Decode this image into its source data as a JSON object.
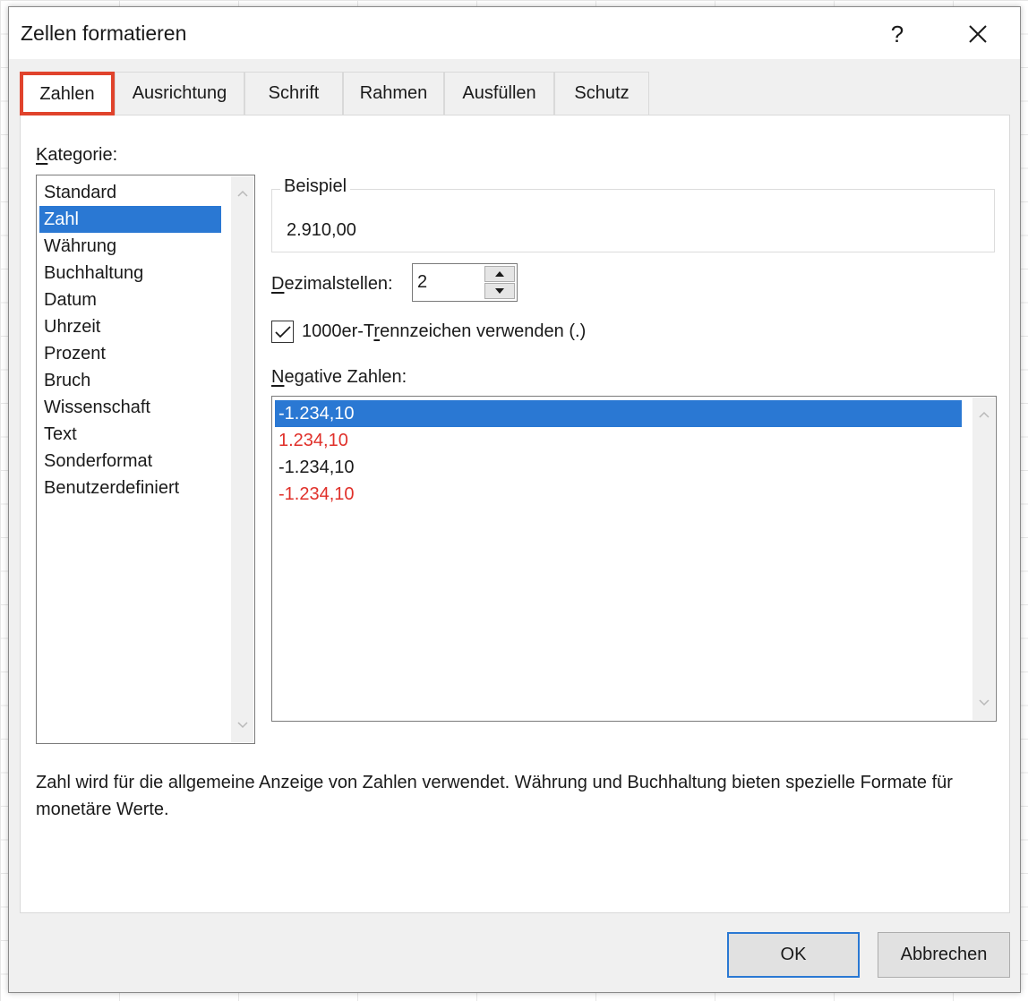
{
  "dialog": {
    "title": "Zellen formatieren",
    "help_label": "?",
    "close_label": "✕"
  },
  "tabs": [
    {
      "label": "Zahlen",
      "active": true
    },
    {
      "label": "Ausrichtung"
    },
    {
      "label": "Schrift"
    },
    {
      "label": "Rahmen"
    },
    {
      "label": "Ausfüllen"
    },
    {
      "label": "Schutz"
    }
  ],
  "category": {
    "label_key": "K",
    "label_rest": "ategorie:",
    "selected": "Zahl",
    "items": [
      "Standard",
      "Zahl",
      "Währung",
      "Buchhaltung",
      "Datum",
      "Uhrzeit",
      "Prozent",
      "Bruch",
      "Wissenschaft",
      "Text",
      "Sonderformat",
      "Benutzerdefiniert"
    ]
  },
  "example": {
    "legend": "Beispiel",
    "value": "2.910,00"
  },
  "decimals": {
    "label_key": "D",
    "label_rest": "ezimalstellen:",
    "value": "2"
  },
  "thousands": {
    "checked": true,
    "label_pre": "1000er-T",
    "label_key": "r",
    "label_post": "ennzeichen verwenden (.)"
  },
  "negative": {
    "label_key": "N",
    "label_rest": "egative Zahlen:",
    "items": [
      {
        "text": "-1.234,10",
        "selected": true,
        "color": "default"
      },
      {
        "text": "1.234,10",
        "color": "#e0302a"
      },
      {
        "text": "-1.234,10",
        "color": "default"
      },
      {
        "text": "-1.234,10",
        "color": "#e0302a"
      }
    ]
  },
  "description": "Zahl wird für die allgemeine Anzeige von Zahlen verwendet. Währung und Buchhaltung bieten spezielle Formate für monetäre Werte.",
  "buttons": {
    "ok": "OK",
    "cancel": "Abbrechen"
  },
  "colors": {
    "accent": "#2a78d3",
    "highlight_red": "#e0432c"
  }
}
